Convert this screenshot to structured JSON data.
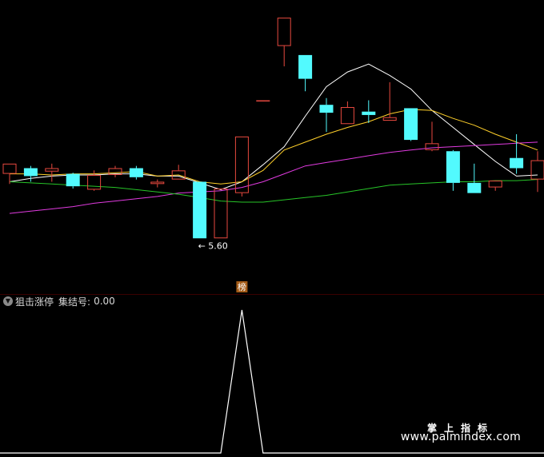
{
  "indicator_panel": {
    "name": "狙击涨停",
    "value_label": "集结号:",
    "value": "0.00"
  },
  "watermark": {
    "brand_cn": "掌上指标",
    "url": "www.palmindex.com"
  },
  "chart_data": [
    {
      "type": "candlestick",
      "title": "",
      "annotations": {
        "low_marker": "← 5.60",
        "signal_badge": "榜"
      },
      "ylim": [
        5.15,
        7.65
      ],
      "colors": {
        "up": "#e8493f",
        "down": "#52fafe",
        "ma5": "#ffffff",
        "ma10": "#ffd02a",
        "ma30": "#e13be0",
        "ma60": "#27c428",
        "divider": "#3a0000"
      },
      "candles": [
        {
          "open": 6.17,
          "high": 6.26,
          "low": 6.08,
          "close": 6.26
        },
        {
          "open": 6.22,
          "high": 6.24,
          "low": 6.1,
          "close": 6.15
        },
        {
          "open": 6.19,
          "high": 6.26,
          "low": 6.1,
          "close": 6.22
        },
        {
          "open": 6.17,
          "high": 6.18,
          "low": 6.04,
          "close": 6.06
        },
        {
          "open": 6.03,
          "high": 6.2,
          "low": 6.02,
          "close": 6.16
        },
        {
          "open": 6.16,
          "high": 6.24,
          "low": 6.14,
          "close": 6.22
        },
        {
          "open": 6.22,
          "high": 6.24,
          "low": 6.12,
          "close": 6.14
        },
        {
          "open": 6.08,
          "high": 6.12,
          "low": 6.05,
          "close": 6.1
        },
        {
          "open": 6.12,
          "high": 6.25,
          "low": 6.12,
          "close": 6.2
        },
        {
          "open": 6.1,
          "high": 6.1,
          "low": 5.6,
          "close": 5.6
        },
        {
          "open": 5.6,
          "high": 6.04,
          "low": 5.6,
          "close": 6.04
        },
        {
          "open": 6.0,
          "high": 6.5,
          "low": 5.97,
          "close": 6.5
        },
        {
          "open": 6.82,
          "high": 6.82,
          "low": 6.82,
          "close": 6.82
        },
        {
          "open": 7.3,
          "high": 7.55,
          "low": 7.12,
          "close": 7.55
        },
        {
          "open": 7.22,
          "high": 7.22,
          "low": 6.9,
          "close": 7.01
        },
        {
          "open": 6.78,
          "high": 6.84,
          "low": 6.54,
          "close": 6.71
        },
        {
          "open": 6.61,
          "high": 6.81,
          "low": 6.61,
          "close": 6.76
        },
        {
          "open": 6.72,
          "high": 6.82,
          "low": 6.62,
          "close": 6.69
        },
        {
          "open": 6.64,
          "high": 6.98,
          "low": 6.64,
          "close": 6.67
        },
        {
          "open": 6.75,
          "high": 6.75,
          "low": 6.46,
          "close": 6.47
        },
        {
          "open": 6.38,
          "high": 6.63,
          "low": 6.37,
          "close": 6.44
        },
        {
          "open": 6.37,
          "high": 6.38,
          "low": 6.02,
          "close": 6.09
        },
        {
          "open": 6.09,
          "high": 6.26,
          "low": 6.0,
          "close": 6.0
        },
        {
          "open": 6.05,
          "high": 6.11,
          "low": 6.02,
          "close": 6.11
        },
        {
          "open": 6.31,
          "high": 6.52,
          "low": 6.17,
          "close": 6.22
        },
        {
          "open": 6.12,
          "high": 6.37,
          "low": 6.01,
          "close": 6.29
        }
      ],
      "series": [
        {
          "values": [
            6.1,
            6.13,
            6.15,
            6.16,
            6.16,
            6.17,
            6.17,
            6.15,
            6.15,
            6.09,
            6.03,
            6.1,
            6.25,
            6.41,
            6.68,
            6.94,
            7.07,
            7.14,
            7.04,
            6.92,
            6.73,
            6.58,
            6.43,
            6.28,
            6.15,
            6.16
          ]
        },
        {
          "values": [
            6.17,
            6.17,
            6.16,
            6.17,
            6.17,
            6.18,
            6.19,
            6.15,
            6.16,
            6.1,
            6.08,
            6.1,
            6.2,
            6.38,
            6.45,
            6.52,
            6.58,
            6.63,
            6.7,
            6.74,
            6.73,
            6.66,
            6.6,
            6.52,
            6.45,
            6.38
          ]
        },
        {
          "values": [
            5.82,
            5.84,
            5.86,
            5.88,
            5.91,
            5.93,
            5.95,
            5.97,
            6.0,
            6.01,
            6.02,
            6.05,
            6.1,
            6.17,
            6.24,
            6.27,
            6.3,
            6.33,
            6.36,
            6.38,
            6.4,
            6.41,
            6.42,
            6.43,
            6.44,
            6.45
          ]
        },
        {
          "values": [
            6.1,
            6.09,
            6.08,
            6.07,
            6.06,
            6.05,
            6.03,
            6.01,
            5.99,
            5.96,
            5.93,
            5.92,
            5.92,
            5.94,
            5.96,
            5.98,
            6.01,
            6.04,
            6.07,
            6.08,
            6.09,
            6.1,
            6.1,
            6.11,
            6.11,
            6.12
          ]
        }
      ]
    },
    {
      "type": "line",
      "title": "",
      "ylim": [
        0,
        1
      ],
      "x": [
        0,
        1,
        2,
        3,
        4,
        5,
        6,
        7,
        8,
        9,
        10,
        11,
        12,
        13,
        14,
        15,
        16,
        17,
        18,
        19,
        20,
        21,
        22,
        23,
        24,
        25
      ],
      "series": [
        {
          "values": [
            0,
            0,
            0,
            0,
            0,
            0,
            0,
            0,
            0,
            0,
            0,
            1,
            0,
            0,
            0,
            0,
            0,
            0,
            0,
            0,
            0,
            0,
            0,
            0,
            0,
            0
          ]
        }
      ]
    }
  ]
}
